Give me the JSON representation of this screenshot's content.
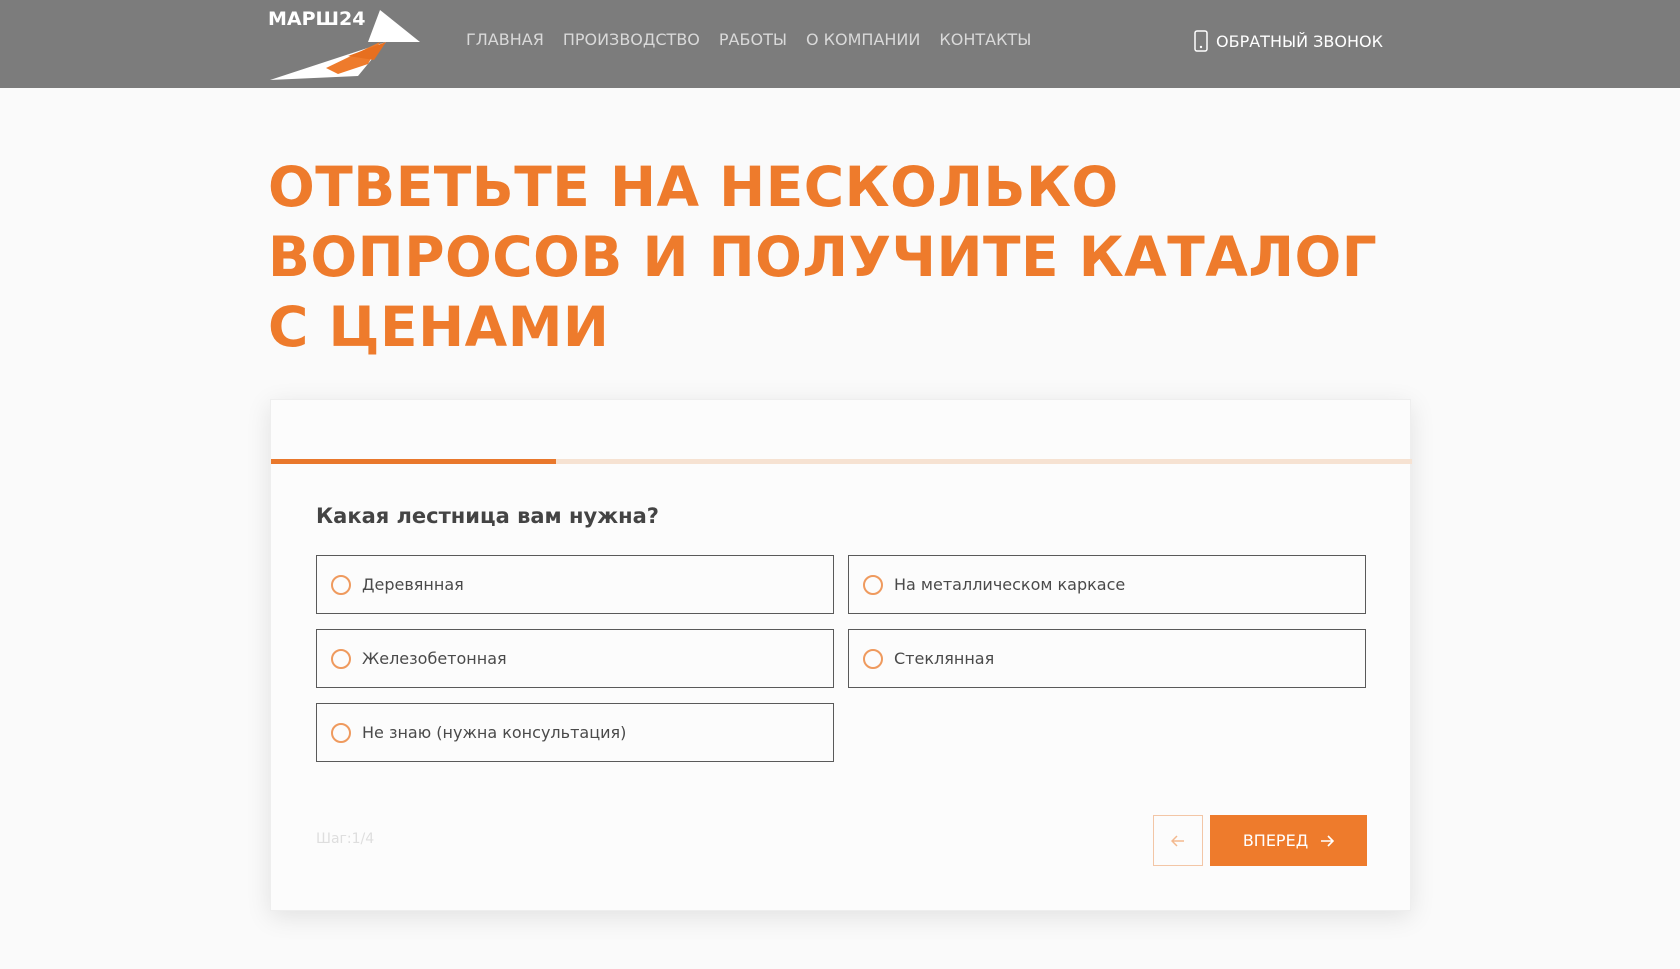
{
  "header": {
    "logo_text": "МАРШ24",
    "nav": [
      {
        "label": "ГЛАВНАЯ"
      },
      {
        "label": "ПРОИЗВОДСТВО"
      },
      {
        "label": "РАБОТЫ"
      },
      {
        "label": "О КОМПАНИИ"
      },
      {
        "label": "КОНТАКТЫ"
      }
    ],
    "callback_label": "ОБРАТНЫЙ ЗВОНОК",
    "callback_icon": "phone-icon"
  },
  "main": {
    "title": "ОТВЕТЬТЕ НА НЕСКОЛЬКО ВОПРОСОВ И ПОЛУЧИТЕ КАТАЛОГ С ЦЕНАМИ"
  },
  "quiz": {
    "progress": 0.25,
    "question": "Какая лестница вам нужна?",
    "options": [
      {
        "label": "Деревянная"
      },
      {
        "label": "На металлическом каркасе"
      },
      {
        "label": "Железобетонная"
      },
      {
        "label": "Стеклянная"
      },
      {
        "label": "Не знаю (нужна консультация)"
      }
    ],
    "step_label": "Шаг:1/4",
    "back_icon": "arrow-left-icon",
    "next_label": "ВПЕРЕД",
    "next_icon": "arrow-right-icon"
  },
  "colors": {
    "accent": "#ee7b2c",
    "header_bg": "#7c7c7c",
    "progress_track": "#f6e2d2"
  }
}
